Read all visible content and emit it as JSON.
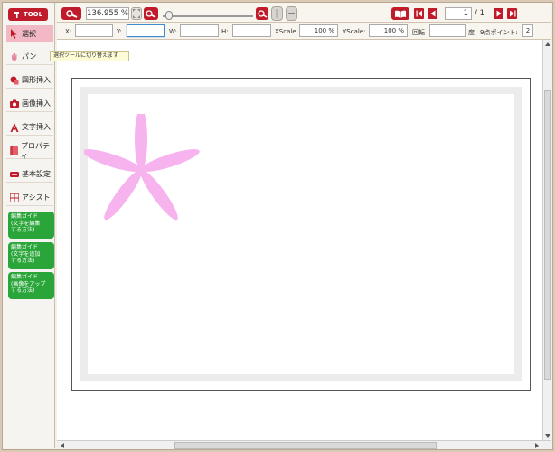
{
  "toolpanel": {
    "badge": "TOOL",
    "items": [
      {
        "label": "選択",
        "icon": "cursor-icon"
      },
      {
        "label": "パン",
        "icon": "hand-icon"
      },
      {
        "label": "図形挿入",
        "icon": "shapes-icon"
      },
      {
        "label": "画像挿入",
        "icon": "camera-icon"
      },
      {
        "label": "文字挿入",
        "icon": "text-icon"
      },
      {
        "label": "プロパティ",
        "icon": "book-icon"
      },
      {
        "label": "基本設定",
        "icon": "settings-icon"
      },
      {
        "label": "アシスト",
        "icon": "grid-icon"
      }
    ],
    "guides": [
      [
        "編集ガイド",
        "(文字を編集",
        "する方法)"
      ],
      [
        "編集ガイド",
        "(文字を追加",
        "する方法)"
      ],
      [
        "編集ガイド",
        "(画像をアップ",
        "する方法)"
      ]
    ]
  },
  "tooltip": "選択ツールに切り替えます",
  "toolbar": {
    "zoom_value": "136.955 %",
    "page_current": "1",
    "page_total": "/ 1"
  },
  "props": {
    "x_label": "X:",
    "x_value": "",
    "y_label": "Y:",
    "y_value": "",
    "w_label": "W:",
    "w_value": "",
    "h_label": "H:",
    "h_value": "",
    "xscale_label": "XScale",
    "xscale_value": "100 %",
    "yscale_label": "YScale:",
    "yscale_value": "100 %",
    "rotate_label": "回転",
    "rotate_value": "",
    "degree_label": "度",
    "points_label": "9点ポイント:",
    "points_value": "2"
  },
  "colors": {
    "accent": "#c01b2a",
    "guide": "#2aa53a",
    "selected": "#f2b8c4",
    "flower": "#f7b3ee"
  }
}
